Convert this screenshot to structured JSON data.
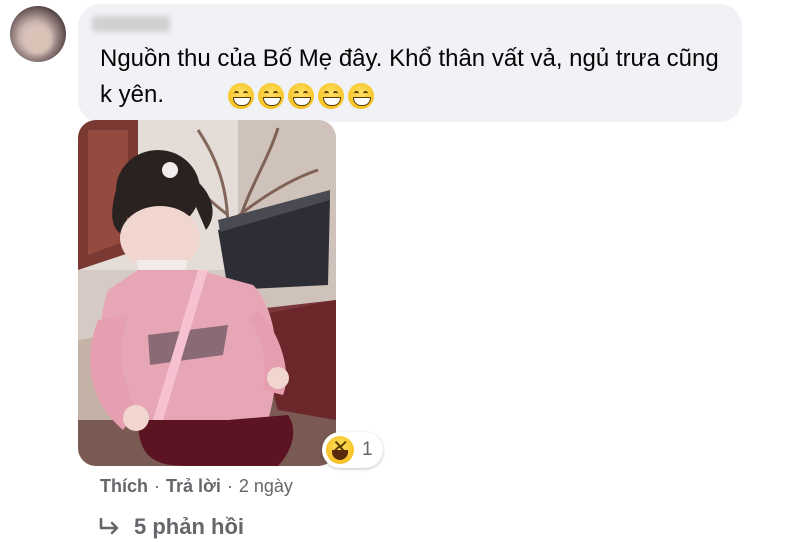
{
  "comment": {
    "text": "Nguồn thu của Bố Mẹ đây. Khổ thân vất vả, ngủ trưa cũng k yên.",
    "emoji": [
      "grin-icon",
      "grin-icon",
      "grin-icon",
      "grin-icon",
      "grin-icon"
    ],
    "reaction": {
      "icon": "haha-icon",
      "count": "1"
    }
  },
  "actions": {
    "like": "Thích",
    "reply": "Trả lời",
    "time": "2 ngày",
    "separator": "·"
  },
  "replies": {
    "label": "5 phản hồi",
    "icon": "reply-arrow-icon"
  },
  "colors": {
    "bubble": "#f0f2f5",
    "text": "#050505",
    "muted": "#65676b"
  }
}
